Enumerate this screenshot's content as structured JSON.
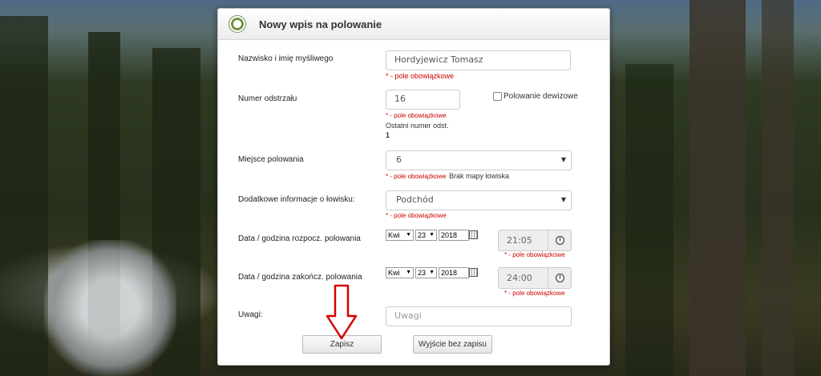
{
  "dialog": {
    "title": "Nowy wpis na polowanie"
  },
  "hunter": {
    "label": "Nazwisko i imię myśliwego",
    "value": "Hordyjewicz Tomasz",
    "required": "* - pole obowiązkowe"
  },
  "shot_number": {
    "label": "Numer odstrzału",
    "value": "16",
    "required": "* - pole obowiązkowe",
    "last_label": "Ostatni numer odst.",
    "last_value": "1"
  },
  "foreign_hunt": {
    "label": "Polowanie dewizowe",
    "checked": false
  },
  "place": {
    "label": "Miejsce polowania",
    "value": "6",
    "required": "* - pole obowiązkowe",
    "note": "Brak mapy łowiska"
  },
  "extra_info": {
    "label": "Dodatkowe informacje o łowisku:",
    "value": "Podchód",
    "required": "* - pole obowiązkowe"
  },
  "start": {
    "label": "Data / godzina rozpocz. polowania",
    "month": "Kwi",
    "day": "23",
    "year": "2018",
    "time": "21:05",
    "required": "* - pole obowiązkowe"
  },
  "end": {
    "label": "Data / godzina zakończ. polowania",
    "month": "Kwi",
    "day": "23",
    "year": "2018",
    "time": "24:00",
    "required": "* - pole obowiązkowe"
  },
  "notes": {
    "label": "Uwagi:",
    "placeholder": "Uwagi"
  },
  "buttons": {
    "save": "Zapisz",
    "exit": "Wyjście bez zapisu"
  },
  "colors": {
    "required": "#cc0000",
    "arrow": "#d40000"
  }
}
